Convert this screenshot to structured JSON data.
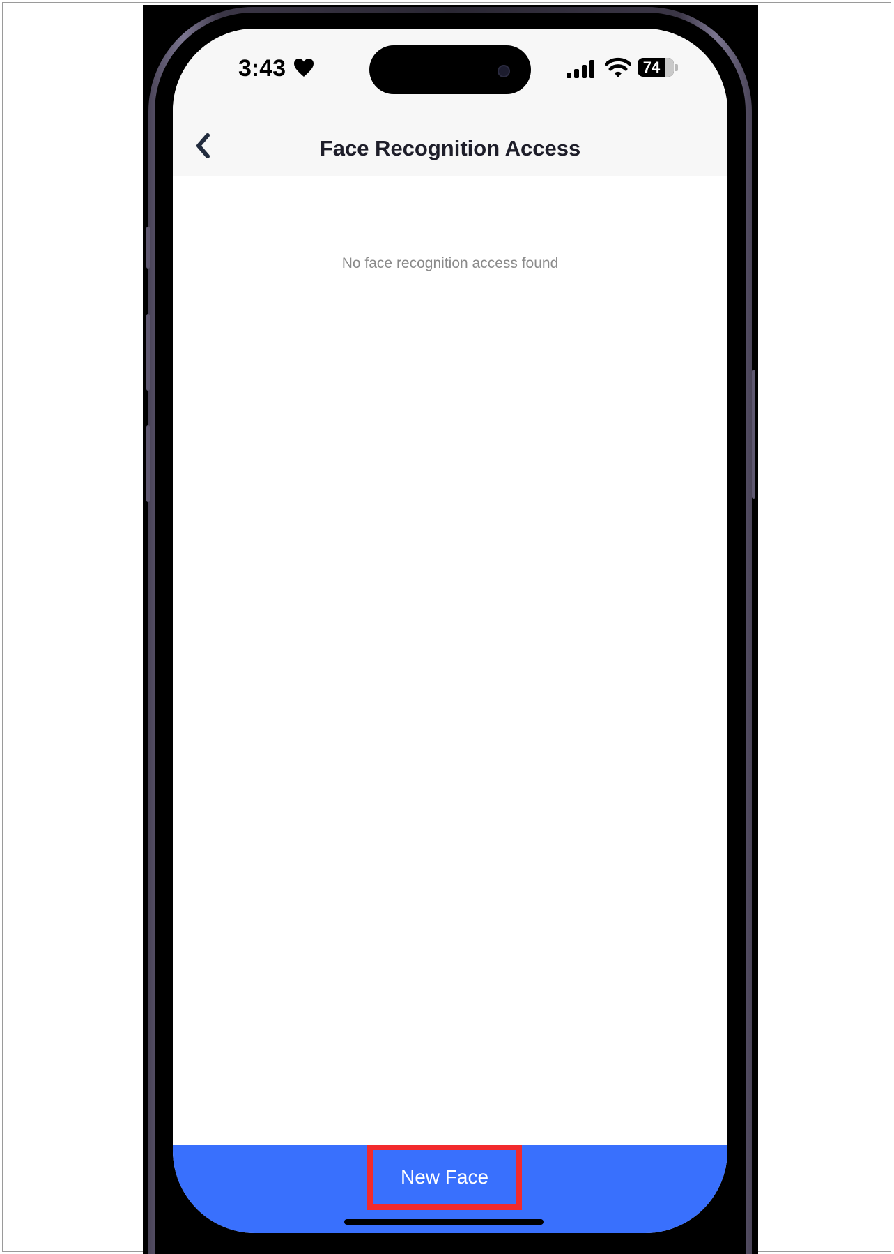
{
  "status_bar": {
    "time": "3:43",
    "battery_level": "74",
    "icons": [
      "heart-icon",
      "signal-icon",
      "wifi-icon",
      "battery-icon"
    ]
  },
  "nav": {
    "title": "Face Recognition Access",
    "back_icon": "chevron-left-icon"
  },
  "content": {
    "empty_message": "No face recognition access found"
  },
  "bottom": {
    "button_label": "New Face"
  },
  "colors": {
    "accent": "#3970fd",
    "highlight": "#f22a2d",
    "nav_background": "#f7f7f7",
    "title_text": "#1e1e2a"
  }
}
